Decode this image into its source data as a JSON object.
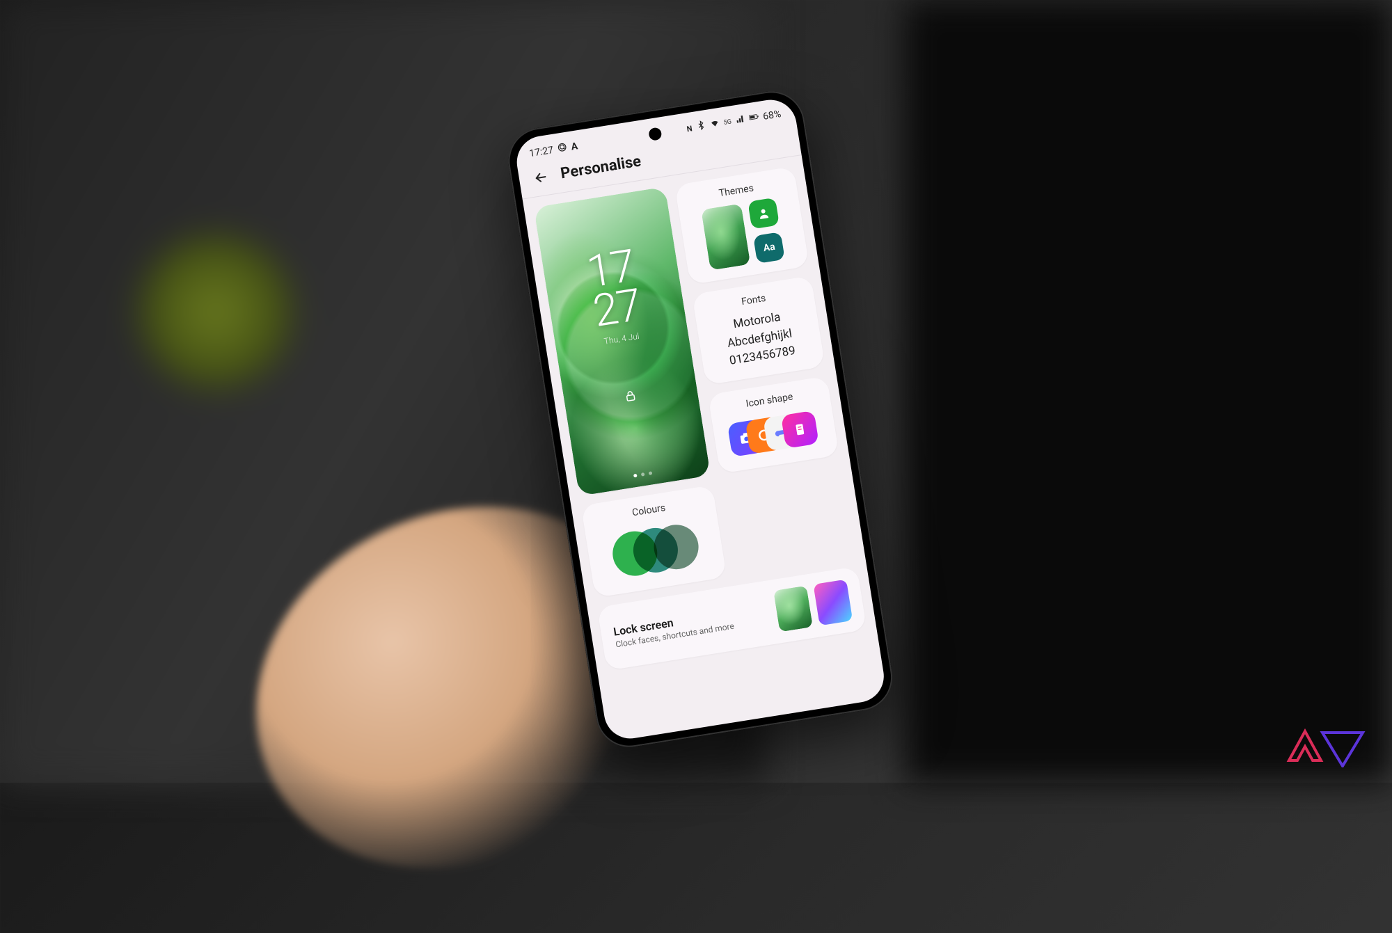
{
  "status": {
    "time": "17:27",
    "network_label": "5G",
    "battery": "68%"
  },
  "header": {
    "title": "Personalise"
  },
  "wallpaper": {
    "clock_hh": "17",
    "clock_mm": "27",
    "date": "Thu, 4 Jul"
  },
  "cards": {
    "themes": {
      "title": "Themes",
      "font_tile_label": "Aa"
    },
    "fonts": {
      "title": "Fonts",
      "line1": "Motorola",
      "line2": "Abcdefghijkl",
      "line3": "0123456789"
    },
    "icon_shape": {
      "title": "Icon shape"
    },
    "colours": {
      "title": "Colours"
    },
    "lock_screen": {
      "title": "Lock screen",
      "subtitle": "Clock faces, shortcuts and more"
    }
  },
  "colors": {
    "accent_green": "#2fb84f",
    "accent_teal": "#0f6b6b",
    "card_bg": "#faf6fa",
    "screen_bg": "#f3eef2"
  }
}
